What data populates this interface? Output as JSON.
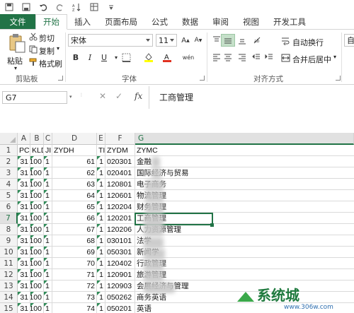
{
  "qat": {
    "icons": [
      "save-icon",
      "floppy-icon",
      "undo-icon",
      "redo-icon",
      "sort-icon",
      "freeze-icon",
      "dropdown-icon"
    ]
  },
  "tabs": [
    "文件",
    "开始",
    "插入",
    "页面布局",
    "公式",
    "数据",
    "审阅",
    "视图",
    "开发工具"
  ],
  "ribbon": {
    "clipboard": {
      "paste": "粘贴",
      "cut": "剪切",
      "copy": "复制",
      "format_painter": "格式刷",
      "label": "剪贴板"
    },
    "font": {
      "name": "宋体",
      "size": "11",
      "bold": "B",
      "italic": "I",
      "underline": "U",
      "label": "字体",
      "wen": "wén"
    },
    "align": {
      "wrap": "自动换行",
      "merge": "合并后居中",
      "label": "对齐方式"
    },
    "number_partial": "自"
  },
  "formula_bar": {
    "name_box": "G7",
    "fx": "fx",
    "value": "工商管理"
  },
  "columns": [
    "A",
    "B",
    "C",
    "D",
    "E",
    "F",
    "G"
  ],
  "rows": [
    {
      "n": "1",
      "a": "PCI",
      "b": "KLDM",
      "c": "JI",
      "d": "ZYDH",
      "e": "TI",
      "f": "ZYDM",
      "g": "ZYMC"
    },
    {
      "n": "2",
      "a": "31",
      "b": "100",
      "c": "1",
      "d": "61",
      "e": "1",
      "f": "020301",
      "g": "金融"
    },
    {
      "n": "3",
      "a": "31",
      "b": "100",
      "c": "1",
      "d": "62",
      "e": "1",
      "f": "020401",
      "g": "国际经济与贸易"
    },
    {
      "n": "4",
      "a": "31",
      "b": "100",
      "c": "1",
      "d": "63",
      "e": "1",
      "f": "120801",
      "g": "电子商务"
    },
    {
      "n": "5",
      "a": "31",
      "b": "100",
      "c": "1",
      "d": "64",
      "e": "1",
      "f": "120601",
      "g": "物流管理"
    },
    {
      "n": "6",
      "a": "31",
      "b": "100",
      "c": "1",
      "d": "65",
      "e": "1",
      "f": "120204",
      "g": "财务管理"
    },
    {
      "n": "7",
      "a": "31",
      "b": "100",
      "c": "1",
      "d": "66",
      "e": "1",
      "f": "120201",
      "g": "工商管理"
    },
    {
      "n": "8",
      "a": "31",
      "b": "100",
      "c": "1",
      "d": "67",
      "e": "1",
      "f": "120206",
      "g": "人力资源管理"
    },
    {
      "n": "9",
      "a": "31",
      "b": "100",
      "c": "1",
      "d": "68",
      "e": "1",
      "f": "030101",
      "g": "法学"
    },
    {
      "n": "10",
      "a": "31",
      "b": "100",
      "c": "1",
      "d": "69",
      "e": "1",
      "f": "050301",
      "g": "新闻学"
    },
    {
      "n": "11",
      "a": "31",
      "b": "100",
      "c": "1",
      "d": "70",
      "e": "1",
      "f": "120402",
      "g": "行政管理"
    },
    {
      "n": "12",
      "a": "31",
      "b": "100",
      "c": "1",
      "d": "71",
      "e": "1",
      "f": "120901",
      "g": "旅游管理"
    },
    {
      "n": "13",
      "a": "31",
      "b": "100",
      "c": "1",
      "d": "72",
      "e": "1",
      "f": "120903",
      "g": "会展经济与管理"
    },
    {
      "n": "14",
      "a": "31",
      "b": "100",
      "c": "1",
      "d": "73",
      "e": "1",
      "f": "050262",
      "g": "商务英语"
    },
    {
      "n": "15",
      "a": "31",
      "b": "100",
      "c": "1",
      "d": "74",
      "e": "1",
      "f": "050201",
      "g": "英语"
    }
  ],
  "watermark": {
    "brand": "系统城",
    "url": "www.306w.com"
  },
  "colors": {
    "accent": "#217346",
    "selection": "#217346",
    "file_tab": "#217346"
  }
}
